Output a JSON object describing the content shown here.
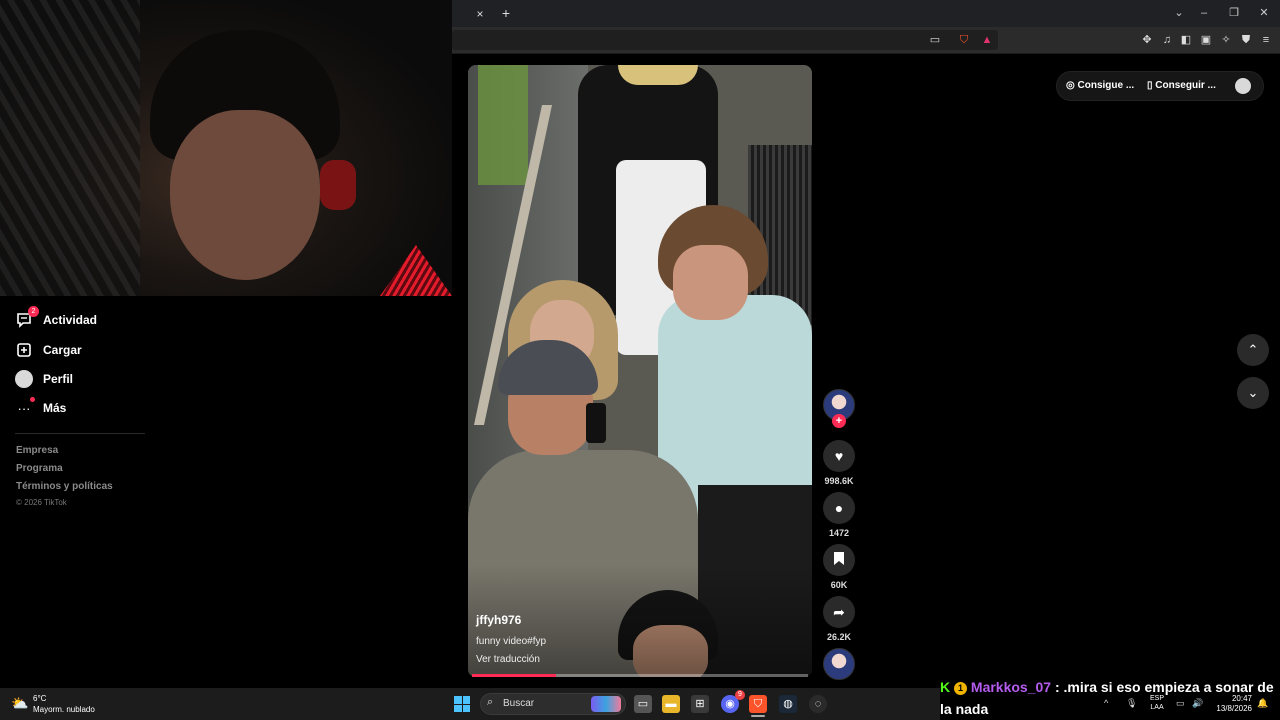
{
  "browser": {
    "tab_close": "×",
    "tab_new": "+",
    "window_controls": [
      "⌄",
      "–",
      "❐",
      "✕"
    ],
    "toolbar_icons": [
      "cast-icon",
      "brave-shield-icon",
      "brave-rewards-icon",
      "extensions-icon",
      "music-icon",
      "sidebar-icon",
      "wallet-icon",
      "leo-ai-icon",
      "vpn-shield-icon",
      "menu-icon"
    ]
  },
  "sidebar": {
    "items": [
      {
        "label": "Actividad",
        "icon": "activity-icon",
        "badge": "2"
      },
      {
        "label": "Cargar",
        "icon": "upload-icon"
      },
      {
        "label": "Perfil",
        "icon": "profile-avatar"
      },
      {
        "label": "Más",
        "icon": "more-icon"
      }
    ],
    "footer": {
      "links": [
        "Empresa",
        "Programa",
        "Términos y políticas"
      ],
      "copyright": "© 2026 TikTok"
    }
  },
  "video": {
    "username": "jffyh976",
    "description": "funny video#fyp",
    "translate": "Ver traducción",
    "progress": 0.25
  },
  "actions": {
    "follow_plus": "+",
    "likes": "998.6K",
    "comments": "1472",
    "saves": "60K",
    "shares": "26.2K"
  },
  "top_right": {
    "coins_label": "Consigue ...",
    "app_label": "Conseguir ..."
  },
  "nav": {
    "up": "⌃",
    "down": "⌄"
  },
  "chat": {
    "platform_badge": "K",
    "sub_badge": "1",
    "username": "Markkos_07",
    "separator": ":",
    "message": ".mira si eso empieza a sonar de la nada"
  },
  "taskbar": {
    "temperature": "6°C",
    "weather": "Mayorm. nublado",
    "search_placeholder": "Buscar",
    "discord_badge": "9",
    "lang_top": "ESP",
    "lang_bottom": "LAA",
    "time": "20:47",
    "date": "13/8/2026",
    "tray_chevron": "^"
  },
  "colors": {
    "tiktok_red": "#fe2c55",
    "kick_green": "#53fc18",
    "chat_username": "#b55cf0",
    "win_accent": "#4cc2ff"
  }
}
